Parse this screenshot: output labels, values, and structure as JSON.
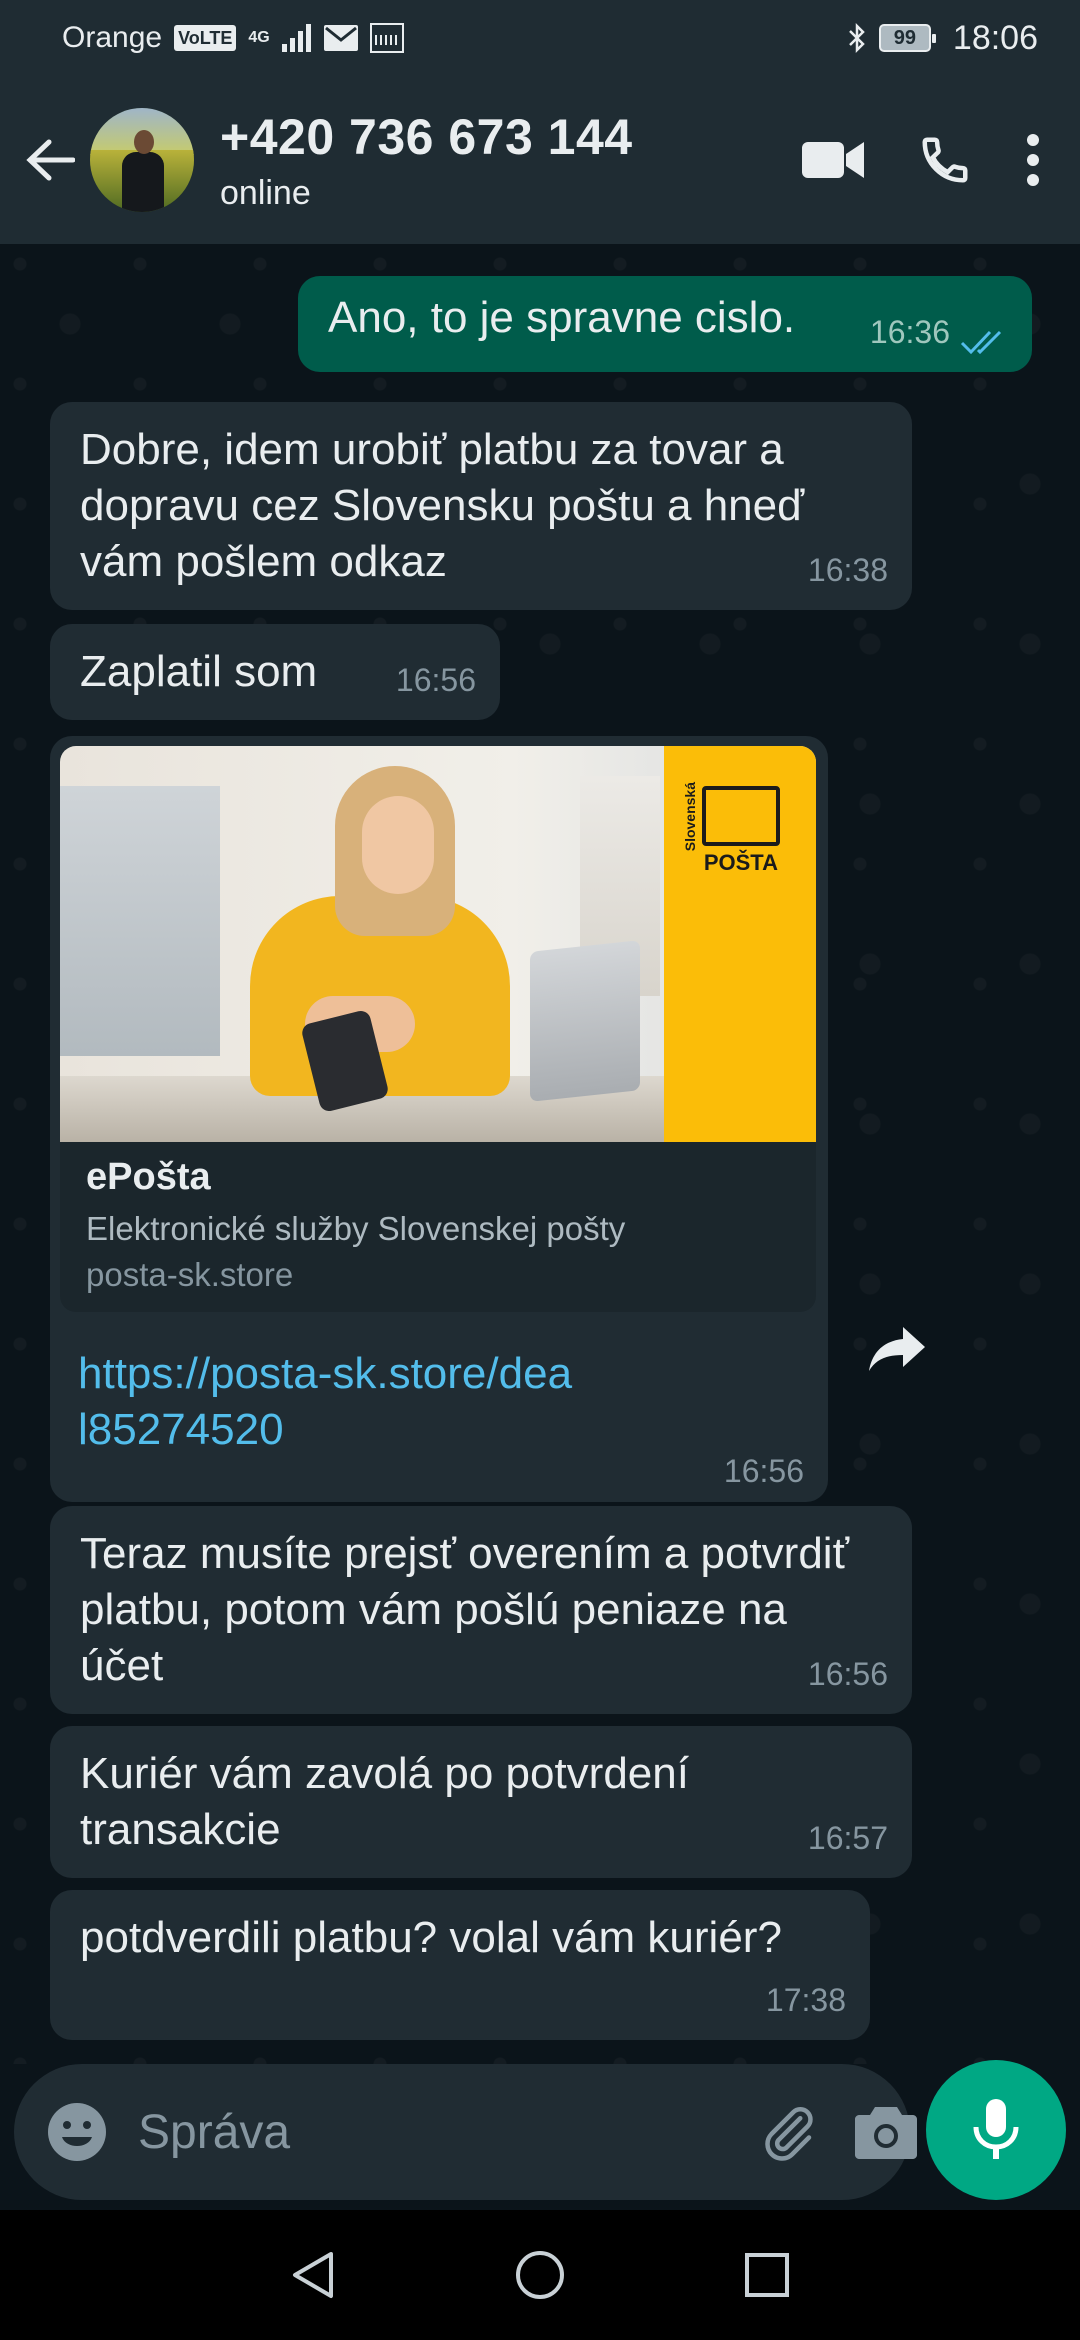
{
  "status_bar": {
    "carrier": "Orange",
    "volte": "VoLTE",
    "network": "4G",
    "battery": "99",
    "time": "18:06"
  },
  "header": {
    "contact_name": "+420 736 673 144",
    "contact_status": "online"
  },
  "messages": [
    {
      "direction": "out",
      "text": "Ano, to je spravne cislo.",
      "time": "16:36",
      "status": "read"
    },
    {
      "direction": "in",
      "text": "Dobre, idem urobiť platbu za tovar a dopravu cez Slovensku poštu a hneď vám pošlem odkaz",
      "time": "16:38"
    },
    {
      "direction": "in",
      "text": "Zaplatil som",
      "time": "16:56"
    },
    {
      "direction": "in",
      "type": "link",
      "card_title": "ePošta",
      "card_description": "Elektronické služby Slovenskej pošty",
      "card_domain": "posta-sk.store",
      "logo_vertical": "Slovenská",
      "logo_word": "POŠTA",
      "link_text": "https://posta-sk.store/deal85274520",
      "time": "16:56"
    },
    {
      "direction": "in",
      "text": "Teraz musíte prejsť overením a potvrdiť platbu, potom vám pošlú peniaze na účet",
      "time": "16:56"
    },
    {
      "direction": "in",
      "text": "Kuriér vám zavolá po potvrdení transakcie",
      "time": "16:57"
    },
    {
      "direction": "in",
      "text": "potdverdili platbu? volal vám kuriér?",
      "time": "17:38"
    }
  ],
  "composer": {
    "placeholder": "Správa"
  },
  "colors": {
    "header_bg": "#1f2c33",
    "chat_bg": "#0b141a",
    "incoming_bubble": "#202c33",
    "outgoing_bubble": "#005c4b",
    "accent": "#00a884",
    "link": "#53bdeb"
  },
  "icons": [
    "back-arrow-icon",
    "video-call-icon",
    "phone-icon",
    "more-vert-icon",
    "read-receipt-icon",
    "forward-icon",
    "emoji-icon",
    "attach-icon",
    "camera-icon",
    "mic-icon",
    "nav-back-icon",
    "nav-home-icon",
    "nav-recents-icon"
  ]
}
